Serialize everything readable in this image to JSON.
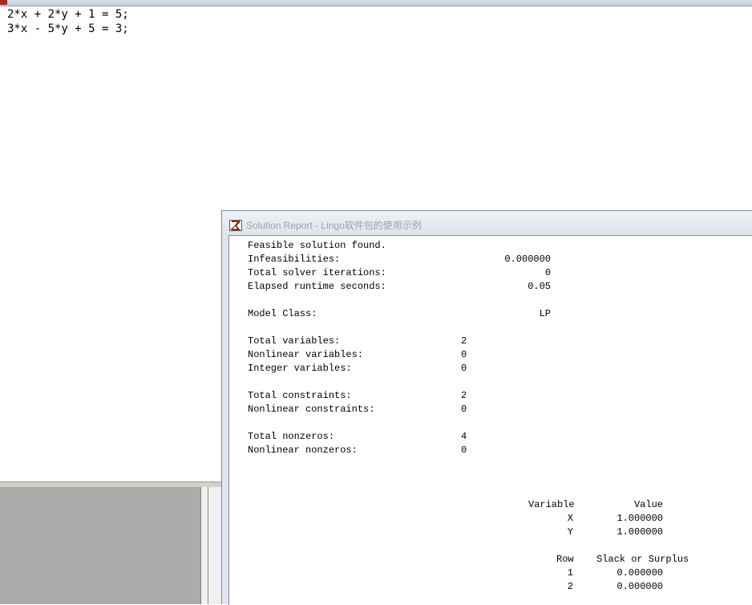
{
  "editor": {
    "code_lines": [
      "2*x + 2*y + 1 = 5;",
      "3*x - 5*y + 5 = 3;"
    ]
  },
  "report": {
    "title": "Solution Report - Lingo软件包的使用示例",
    "status": "Feasible solution found.",
    "infeasibilities": {
      "label": "Infeasibilities:",
      "value": "0.000000"
    },
    "solver_iterations": {
      "label": "Total solver iterations:",
      "value": "0"
    },
    "elapsed_runtime": {
      "label": "Elapsed runtime seconds:",
      "value": "0.05"
    },
    "model_class": {
      "label": "Model Class:",
      "value": "LP"
    },
    "total_variables": {
      "label": "Total variables:",
      "value": "2"
    },
    "nonlinear_variables": {
      "label": "Nonlinear variables:",
      "value": "0"
    },
    "integer_variables": {
      "label": "Integer variables:",
      "value": "0"
    },
    "total_constraints": {
      "label": "Total constraints:",
      "value": "2"
    },
    "nonlinear_constraints": {
      "label": "Nonlinear constraints:",
      "value": "0"
    },
    "total_nonzeros": {
      "label": "Total nonzeros:",
      "value": "4"
    },
    "nonlinear_nonzeros": {
      "label": "Nonlinear nonzeros:",
      "value": "0"
    },
    "variables_table": {
      "headers": [
        "Variable",
        "Value"
      ],
      "rows": [
        [
          "X",
          "1.000000"
        ],
        [
          "Y",
          "1.000000"
        ]
      ]
    },
    "rows_table": {
      "headers": [
        "Row",
        "Slack or Surplus"
      ],
      "rows": [
        [
          "1",
          "0.000000"
        ],
        [
          "2",
          "0.000000"
        ]
      ]
    }
  },
  "colors": {
    "titlebar": "#dde4ec",
    "title_text": "#9aa2ad",
    "mdi_background": "#ababab",
    "icon_red": "#b0261f"
  }
}
